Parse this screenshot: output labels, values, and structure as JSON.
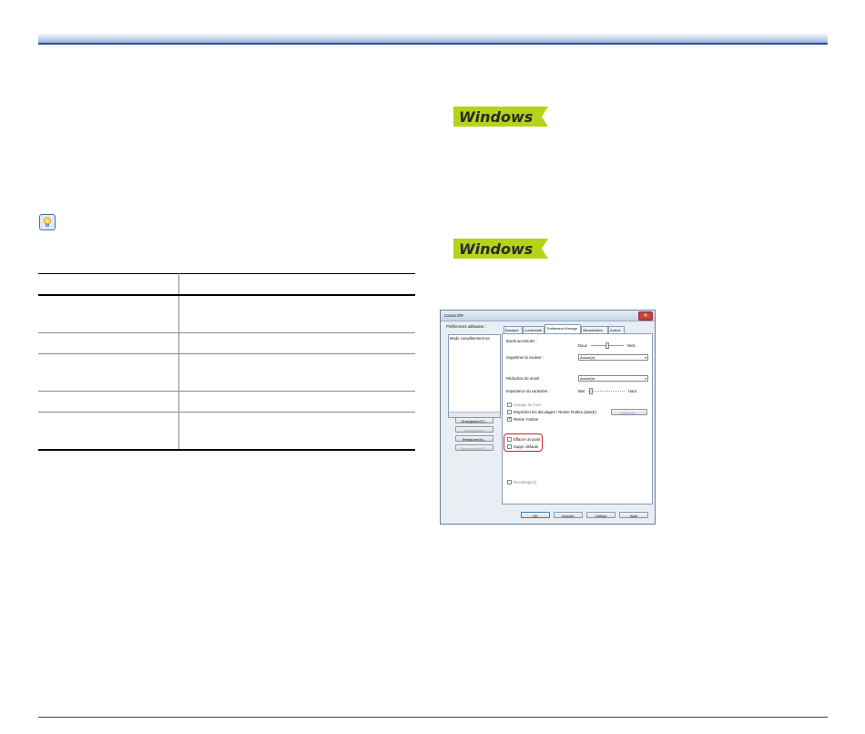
{
  "badges": [
    {
      "text": "Windows"
    },
    {
      "text": "Windows"
    }
  ],
  "dialog": {
    "title": "Canon DR-",
    "close_glyph": "✕",
    "left_pane": {
      "label": "Préférences utilisateur :",
      "list_item": "Mode complètement sa",
      "buttons": [
        {
          "label": "Enregistrer(Y)...",
          "enabled": true
        },
        {
          "label": "Supprimer(I)",
          "enabled": false
        },
        {
          "label": "Restaurer(A)...",
          "enabled": true
        },
        {
          "label": "Sauvegarder(E)...",
          "enabled": false
        }
      ]
    },
    "tabs": [
      "Basique",
      "Luminosité",
      "Traitement d'image",
      "Alimentation",
      "Autres"
    ],
    "active_tab": "Traitement d'image",
    "fields": {
      "edge_emphasis_label": "Bords accentués :",
      "edge_min": "Doux",
      "edge_max": "Nets",
      "color_drop_label": "Supprimer la couleur :",
      "color_drop_value": "Aucun(e)",
      "moire_label": "Réduction de moiré :",
      "moire_value": "Aucun(e)",
      "char_thickness_label": "Importance du caractère :",
      "char_min": "Bas",
      "char_max": "Haut",
      "bg_smoothing": "Lissage du fond",
      "prevent_bleed": "Empêcher les décalages / Retirer fenêtre plan(E)",
      "prevent_bleed_button": "Définir(S)...",
      "remove_shadow": "Retirer l'ombre",
      "erase_dot": "Effacer un point",
      "erase_notch": "Suppr. défauts",
      "deskew": "Recadrage(J)"
    },
    "footer_buttons": [
      "OK",
      "Annuler",
      "Défaut",
      "Aide"
    ]
  }
}
